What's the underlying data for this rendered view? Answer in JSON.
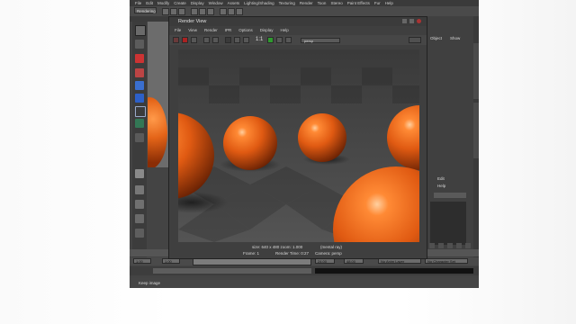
{
  "app": {
    "mode_menu": "Rendering",
    "menus": [
      "File",
      "Edit",
      "Modify",
      "Create",
      "Display",
      "Window",
      "Assets",
      "Lighting/Shading",
      "Texturing",
      "Render",
      "Toon",
      "Stereo",
      "Paint Effects",
      "Fur",
      "Help"
    ],
    "shelf_tabs": [
      "General",
      "Curves",
      "Surfaces",
      "Polygons",
      "Subdiv",
      "Deformation",
      "Animation",
      "Dynamics",
      "Rendering"
    ],
    "channel_box": {
      "header": "Object",
      "show_label": "Show",
      "edit_label": "Edit",
      "help_label": "Help",
      "tab_label": "Channel Box / Layer Editor"
    },
    "timeline": {
      "start": "1.00",
      "current": "1.00",
      "end": "24.00",
      "range_end": "48.00",
      "anim_layer": "No Anim Layer",
      "char_set": "No Character Set"
    },
    "help_line": "Keep image"
  },
  "render_view": {
    "title": "Render View",
    "menus": [
      "File",
      "View",
      "Render",
      "IPR",
      "Options",
      "Display",
      "Help"
    ],
    "ratio_label": "1:1",
    "camera_select": "persp",
    "status": "size: 640 x 480 zoom: 1.000",
    "renderer": "(mental ray)",
    "frame_label": "Frame: 1",
    "render_time": "Render Time: 0:27",
    "camera_label": "Camera: persp"
  },
  "colors": {
    "accent_orange": "#e46418",
    "ui_dark": "#3f3f3f",
    "highlight_green": "#2f9a2f"
  }
}
